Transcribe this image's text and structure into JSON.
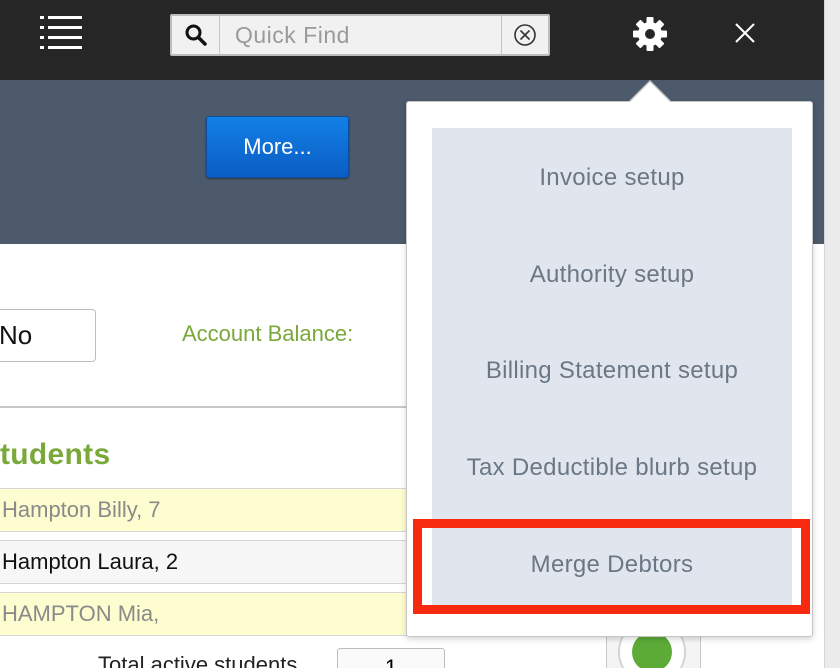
{
  "topbar": {
    "search_placeholder": "Quick Find",
    "icons": [
      "list-menu-icon",
      "search-icon",
      "clear-circle-icon",
      "gear-icon",
      "close-icon"
    ]
  },
  "header": {
    "more_label": "More..."
  },
  "form": {
    "flag_value": "No",
    "account_balance_label": "Account Balance:"
  },
  "students": {
    "heading": "tudents",
    "rows": [
      {
        "text": "Hampton Billy, 7",
        "style": "yellow"
      },
      {
        "text": "Hampton Laura, 2",
        "style": "white"
      },
      {
        "text": "HAMPTON Mia,",
        "style": "yellow"
      }
    ],
    "total_label": "Total active students",
    "total_value": "1"
  },
  "settings_menu": {
    "items": [
      {
        "label": "Invoice setup"
      },
      {
        "label": "Authority setup"
      },
      {
        "label": "Billing Statement setup"
      },
      {
        "label": "Tax Deductible blurb setup"
      },
      {
        "label": "Merge Debtors",
        "highlighted": true
      }
    ]
  },
  "colors": {
    "topbar": "#262626",
    "header": "#4c5a6b",
    "accent_green": "#7aa83a",
    "button_blue": "#0a6fd8",
    "menu_panel": "#e1e6ee",
    "highlight": "#f72a10",
    "status_green": "#5cab37"
  }
}
